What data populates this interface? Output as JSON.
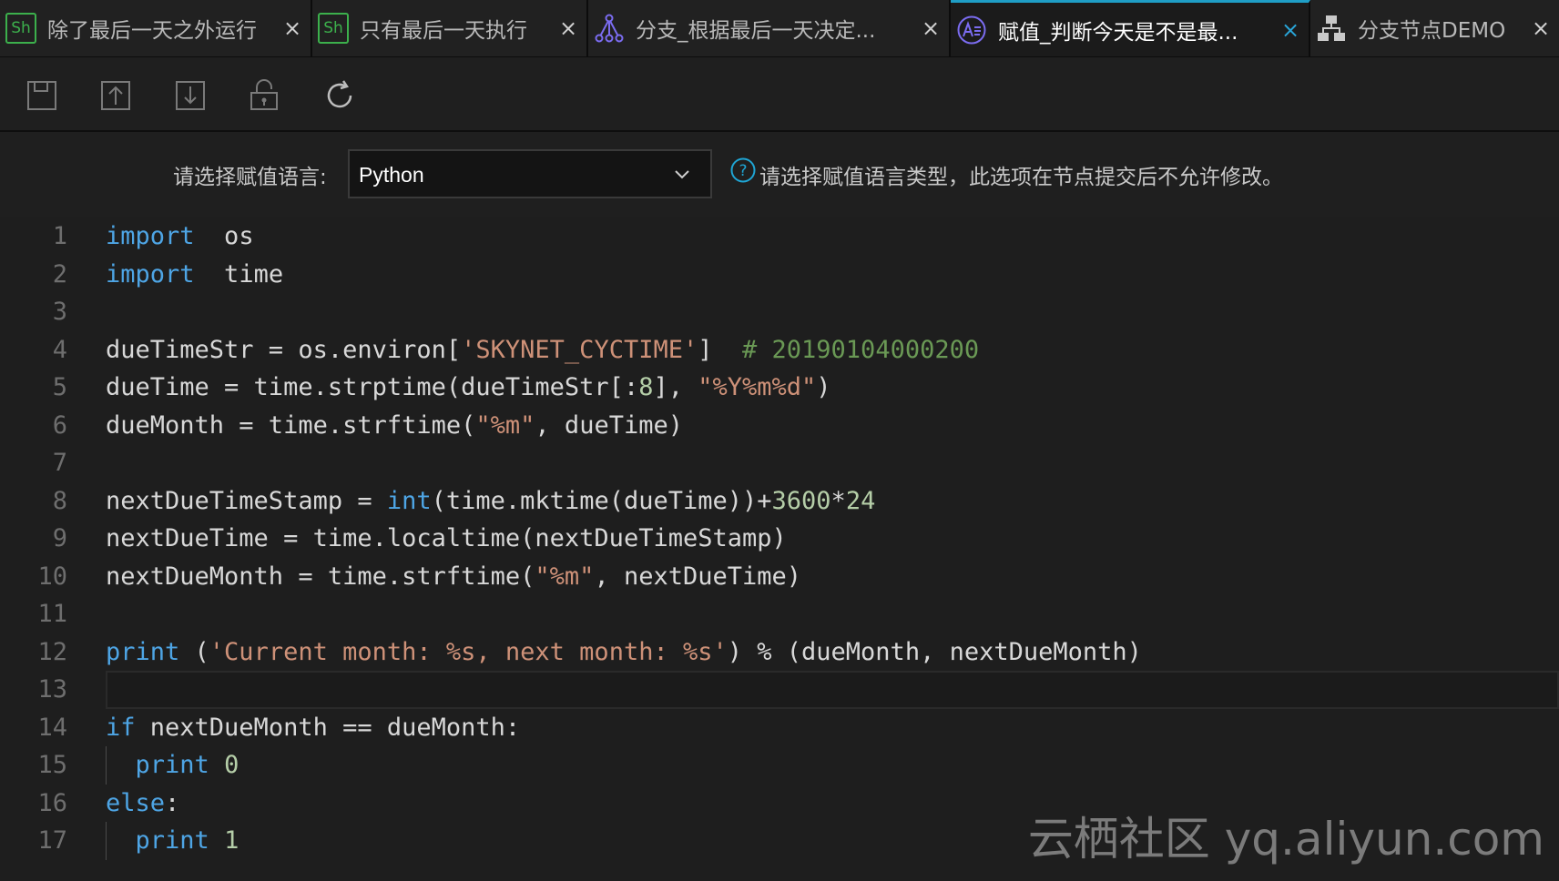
{
  "tabs": [
    {
      "label": "除了最后一天之外运行",
      "icon": "sh-icon",
      "close": "×"
    },
    {
      "label": "只有最后一天执行",
      "icon": "sh-icon",
      "close": "×"
    },
    {
      "label": "分支_根据最后一天决定...",
      "icon": "branch-icon",
      "close": "×"
    },
    {
      "label": "赋值_判断今天是不是最...",
      "icon": "assignment-icon",
      "close": "×",
      "active": true
    },
    {
      "label": "分支节点DEMO",
      "icon": "hierarchy-icon",
      "close": "×"
    }
  ],
  "sh_icon_text": "Sh",
  "toolbar": {
    "buttons": [
      "save-icon",
      "upload-icon",
      "download-icon",
      "unlock-icon",
      "refresh-icon"
    ]
  },
  "language": {
    "label": "请选择赋值语言:",
    "selected": "Python",
    "help_text": "请选择赋值语言类型，此选项在节点提交后不允许修改。"
  },
  "editor": {
    "lines": [
      [
        [
          "kw",
          "import"
        ],
        [
          "",
          "  os"
        ]
      ],
      [
        [
          "kw",
          "import"
        ],
        [
          "",
          "  time"
        ]
      ],
      [],
      [
        [
          "",
          "dueTimeStr = os.environ["
        ],
        [
          "str",
          "'SKYNET_CYCTIME'"
        ],
        [
          "",
          "]  "
        ],
        [
          "com",
          "# 20190104000200"
        ]
      ],
      [
        [
          "",
          "dueTime = time.strptime(dueTimeStr[:"
        ],
        [
          "num",
          "8"
        ],
        [
          "",
          "], "
        ],
        [
          "str",
          "\"%Y%m%d\""
        ],
        [
          "",
          ")"
        ]
      ],
      [
        [
          "",
          "dueMonth = time.strftime("
        ],
        [
          "str",
          "\"%m\""
        ],
        [
          "",
          ", dueTime)"
        ]
      ],
      [],
      [
        [
          "",
          "nextDueTimeStamp = "
        ],
        [
          "fn",
          "int"
        ],
        [
          "",
          "(time.mktime(dueTime))+"
        ],
        [
          "num",
          "3600"
        ],
        [
          "",
          "*"
        ],
        [
          "num",
          "24"
        ]
      ],
      [
        [
          "",
          "nextDueTime = time.localtime(nextDueTimeStamp)"
        ]
      ],
      [
        [
          "",
          "nextDueMonth = time.strftime("
        ],
        [
          "str",
          "\"%m\""
        ],
        [
          "",
          ", nextDueTime)"
        ]
      ],
      [],
      [
        [
          "kw",
          "print"
        ],
        [
          "",
          " ("
        ],
        [
          "str",
          "'Current month: %s, next month: %s'"
        ],
        [
          "",
          ") % (dueMonth, nextDueMonth)"
        ]
      ],
      [],
      [
        [
          "kw",
          "if"
        ],
        [
          "",
          " nextDueMonth == dueMonth:"
        ]
      ],
      [
        [
          "",
          "  "
        ],
        [
          "kw",
          "print"
        ],
        [
          "",
          " "
        ],
        [
          "num",
          "0"
        ]
      ],
      [
        [
          "kw",
          "else"
        ],
        [
          "",
          ":"
        ]
      ],
      [
        [
          "",
          "  "
        ],
        [
          "kw",
          "print"
        ],
        [
          "",
          " "
        ],
        [
          "num",
          "1"
        ]
      ]
    ],
    "current_line": 13,
    "indented_lines": [
      15,
      17
    ]
  },
  "watermark": "云栖社区 yq.aliyun.com",
  "colors": {
    "accent": "#1f9ec6",
    "keyword": "#4ea5e5",
    "string": "#ce9178",
    "number": "#b5cea8",
    "comment": "#6a9955",
    "sh_green": "#3cb04c",
    "branch_purple": "#7b6cf0"
  }
}
